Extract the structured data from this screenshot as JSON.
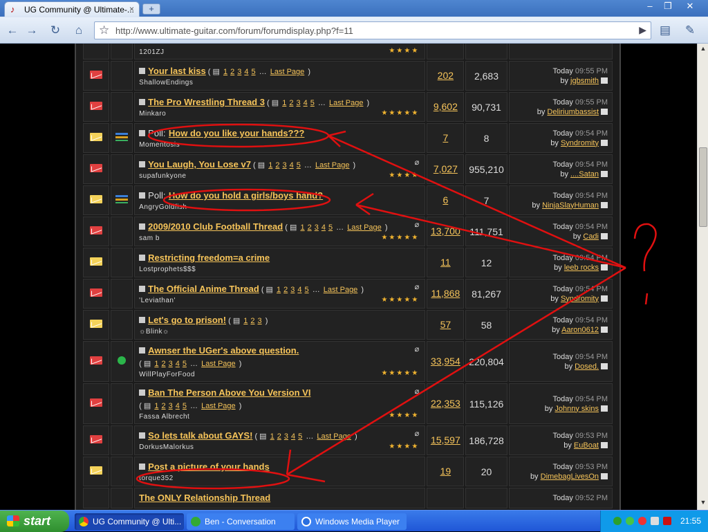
{
  "browser": {
    "tab_title": "UG Community @ Ultimate-...",
    "tab_close": "×",
    "newtab": "+",
    "url": "http://www.ultimate-guitar.com/forum/forumdisplay.php?f=11"
  },
  "forum": {
    "top_partial": {
      "author": "1201ZJ",
      "stars": "★★★★"
    },
    "threads": [
      {
        "icon": "red",
        "poll": false,
        "prefix": "",
        "title": "Your last kiss",
        "pages": [
          "1",
          "2",
          "3",
          "4",
          "5"
        ],
        "last": "Last Page",
        "author": "ShallowEndings",
        "stars": "",
        "clip": false,
        "replies": "202",
        "views": "2,683",
        "when": "Today",
        "time": "09:55 PM",
        "by_label": "by",
        "by": "jgbsmith"
      },
      {
        "icon": "red",
        "poll": false,
        "prefix": "",
        "title": "The Pro Wrestling Thread 3",
        "pages": [
          "1",
          "2",
          "3",
          "4",
          "5"
        ],
        "last": "Last Page",
        "author": "Minkaro",
        "stars": "★★★★★",
        "clip": false,
        "replies": "9,602",
        "views": "90,731",
        "when": "Today",
        "time": "09:55 PM",
        "by_label": "by",
        "by": "Deliriumbassist"
      },
      {
        "icon": "yel",
        "poll": true,
        "prefix": "Poll:",
        "title": "How do you like your hands???",
        "pages": [],
        "last": "",
        "author": "Momentosis",
        "stars": "",
        "clip": false,
        "replies": "7",
        "views": "8",
        "when": "Today",
        "time": "09:54 PM",
        "by_label": "by",
        "by": "Syndromity"
      },
      {
        "icon": "red",
        "poll": false,
        "prefix": "",
        "title": "You Laugh, You Lose v7",
        "pages": [
          "1",
          "2",
          "3",
          "4",
          "5"
        ],
        "last": "Last Page",
        "author": "supafunkyone",
        "stars": "★★★★",
        "clip": true,
        "replies": "7,027",
        "views": "955,210",
        "when": "Today",
        "time": "09:54 PM",
        "by_label": "by",
        "by": "....Satan"
      },
      {
        "icon": "yel",
        "poll": true,
        "prefix": "Poll:",
        "title": "How do you hold a girls/boys hand?",
        "pages": [],
        "last": "",
        "author": "AngryGoldfish",
        "stars": "",
        "clip": false,
        "replies": "6",
        "views": "7",
        "when": "Today",
        "time": "09:54 PM",
        "by_label": "by",
        "by": "NinjaSlayHuman"
      },
      {
        "icon": "red",
        "poll": false,
        "prefix": "",
        "title": "2009/2010 Club Football Thread",
        "pages": [
          "1",
          "2",
          "3",
          "4",
          "5"
        ],
        "last": "Last Page",
        "author": "sam b",
        "stars": "★★★★★",
        "clip": true,
        "replies": "13,700",
        "views": "111,751",
        "when": "Today",
        "time": "09:54 PM",
        "by_label": "by",
        "by": "Cadi"
      },
      {
        "icon": "yel",
        "poll": false,
        "prefix": "",
        "title": "Restricting freedom=a crime",
        "pages": [],
        "last": "",
        "author": "Lostprophets$$$",
        "stars": "",
        "clip": false,
        "replies": "11",
        "views": "12",
        "when": "Today",
        "time": "09:54 PM",
        "by_label": "by",
        "by": "leeb rocks"
      },
      {
        "icon": "red",
        "poll": false,
        "prefix": "",
        "title": "The Official Anime Thread",
        "pages": [
          "1",
          "2",
          "3",
          "4",
          "5"
        ],
        "last": "Last Page",
        "author": "'Leviathan'",
        "stars": "★★★★★",
        "clip": true,
        "replies": "11,868",
        "views": "81,267",
        "when": "Today",
        "time": "09:54 PM",
        "by_label": "by",
        "by": "Syndromity"
      },
      {
        "icon": "yel",
        "poll": false,
        "prefix": "",
        "title": "Let's go to prison!",
        "pages": [
          "1",
          "2",
          "3"
        ],
        "last": "",
        "author": "☼Blink☼",
        "stars": "",
        "clip": false,
        "replies": "57",
        "views": "58",
        "when": "Today",
        "time": "09:54 PM",
        "by_label": "by",
        "by": "Aaron0612"
      },
      {
        "icon": "red",
        "poll": false,
        "dot": true,
        "prefix": "",
        "title": "Awnser the UGer's above question.",
        "pages": [
          "1",
          "2",
          "3",
          "4",
          "5"
        ],
        "last": "Last Page",
        "author": "WillPlayForFood",
        "stars": "★★★★★",
        "clip": true,
        "replies": "33,954",
        "views": "220,804",
        "when": "Today",
        "time": "09:54 PM",
        "by_label": "by",
        "by": "Dosed."
      },
      {
        "icon": "red",
        "poll": false,
        "prefix": "",
        "title": "Ban The Person Above You Version VI",
        "pages": [
          "1",
          "2",
          "3",
          "4",
          "5"
        ],
        "last": "Last Page",
        "author": "Fassa Albrecht",
        "stars": "★★★★",
        "clip": true,
        "replies": "22,353",
        "views": "115,126",
        "when": "Today",
        "time": "09:54 PM",
        "by_label": "by",
        "by": "Johnny skins"
      },
      {
        "icon": "red",
        "poll": false,
        "prefix": "",
        "title": "So lets talk about GAYS!",
        "pages": [
          "1",
          "2",
          "3",
          "4",
          "5"
        ],
        "last": "Last Page",
        "author": "DorkusMalorkus",
        "stars": "★★★★",
        "clip": true,
        "replies": "15,597",
        "views": "186,728",
        "when": "Today",
        "time": "09:53 PM",
        "by_label": "by",
        "by": "EuBoat"
      },
      {
        "icon": "yel",
        "poll": false,
        "prefix": "",
        "title": "Post a picture of your hands",
        "pages": [],
        "last": "",
        "author": "torque352",
        "stars": "",
        "clip": false,
        "replies": "19",
        "views": "20",
        "when": "Today",
        "time": "09:53 PM",
        "by_label": "by",
        "by": "DimebagLivesOn"
      }
    ],
    "bottom_partial": {
      "title": "The ONLY Relationship Thread",
      "when": "Today",
      "time": "09:52 PM"
    }
  },
  "annotation": {
    "mark": "?",
    "color": "#e01010"
  },
  "taskbar": {
    "start": "start",
    "tasks": [
      {
        "label": "UG Community @ Ulti...",
        "active": true
      },
      {
        "label": "Ben - Conversation",
        "active": false
      },
      {
        "label": "Windows Media Player",
        "active": false
      }
    ],
    "clock": "21:55"
  }
}
